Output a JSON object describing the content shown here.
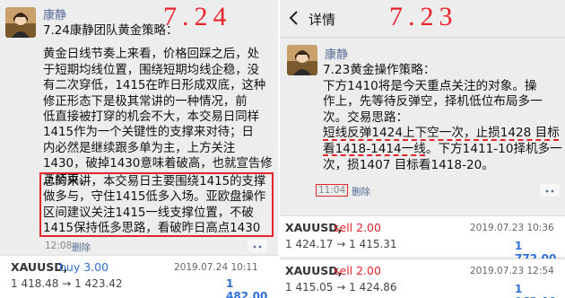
{
  "left_post": {
    "date_overlay": "7.24",
    "author": "康静",
    "lines": [
      "7.24康静团队黄金策略：",
      "",
      "黄金日线节奏上来看，价格回踩之后，处",
      "于短期均线位置，围绕短期均线企稳，没",
      "有二次穿低，1415在昨日形成双底，这种",
      "修正形态下是极其常讲的一种情况，前",
      "低直接被打穿的机会不大，本交易日同样",
      "1415作为一个关键性的支撑来对待；日",
      "内必然是继续跟多单为主，上方关注",
      "1430，破掉1430意味着破高，也就宣告修",
      "正结束。"
    ],
    "highlight_lines": [
      "总的来讲，本交易日主要围绕1415的支撑",
      "做多与，守住1415低多入场。亚欧盘操作",
      "区间建议关注1415一线支撑位置，不破",
      "1415保持低多思路，看破昨日高点1430"
    ],
    "time": "12:08",
    "delete_label": "删除"
  },
  "left_trade": {
    "symbol": "XAUUSD,",
    "side": "buy 3.00",
    "prices": "1 418.48 → 1 423.42",
    "date": "2019.07.24 10:11",
    "profit": "1 482.00"
  },
  "right_header": {
    "title": "详情"
  },
  "right_post": {
    "date_overlay": "7.23",
    "author": "康静",
    "lines_before": [
      "7.23黄金操作策略：",
      "下方1410将是今天重点关注的对象。操",
      "作上，先等待反弹空，择机低位布局多一",
      "次。交易思路："
    ],
    "underlined_lines": [
      "短线反弹1424上下空一次，止损1428 目标",
      "看1418-1414一线"
    ],
    "tail_line_1": "。下方1411-10择机多一",
    "lines_after": [
      "次，损1407 目标看1418-20。"
    ],
    "time": "11:04",
    "delete_label": "删除"
  },
  "right_trades": [
    {
      "symbol": "XAUUSD,",
      "side": "sell 2.00",
      "prices": "1 424.17 → 1 415.31",
      "date": "2019.07.23 10:36",
      "profit": "1 772.00",
      "side_color": "#e0262a"
    },
    {
      "symbol": "XAUUSD,",
      "side": "sell 2.00",
      "prices": "1 415.05 → 1 424.86",
      "date": "2019.07.23 12:54",
      "profit": "1 962.00",
      "side_color": "#e0262a"
    }
  ]
}
